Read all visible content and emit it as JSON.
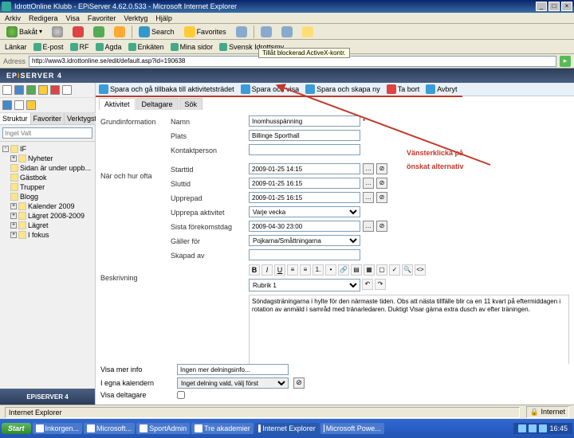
{
  "titlebar": {
    "title": "IdrottOnline Klubb - EPiServer 4.62.0.533 - Microsoft Internet Explorer"
  },
  "menubar": {
    "items": [
      "Arkiv",
      "Redigera",
      "Visa",
      "Favoriter",
      "Verktyg",
      "Hjälp"
    ]
  },
  "ie_toolbar": {
    "back": "Bakåt",
    "search": "Search",
    "favorites": "Favorites"
  },
  "links_toolbar": {
    "label": "Länkar",
    "items": [
      "E-post",
      "RF",
      "Agda",
      "Enkäten",
      "Mina sidor",
      "Svensk Idrottsmy"
    ]
  },
  "address": {
    "label": "Adress",
    "url": "http://www3.idrottonline.se/edit/default.asp?id=190638"
  },
  "addon_popup": "Tillåt blockerad ActiveX-kontr.",
  "epi_brand": "EPiSERVER 4",
  "left": {
    "tabs": [
      "Struktur",
      "Favoriter",
      "Verktygsfält"
    ],
    "search_placeholder": "Inget Valt",
    "tree": {
      "root": "IF",
      "items": [
        "Nyheter",
        "Sidan är under uppb...",
        "Gästbok",
        "Trupper",
        "Blogg",
        "Kalender 2009",
        "Lägret 2008-2009",
        "Lägret",
        "I fokus"
      ]
    },
    "footer": "EPiSERVER 4"
  },
  "action_bar": {
    "save_return": "Spara och gå tillbaka till aktivitetsträdet",
    "save_view": "Spara och visa",
    "save_as": "Spara och skapa ny",
    "delete": "Ta bort",
    "cancel": "Avbryt"
  },
  "form_tabs": [
    "Aktivitet",
    "Deltagare",
    "Sök"
  ],
  "form": {
    "group1_label": "Grundinformation",
    "name_label": "Namn",
    "name_value": "Inomhusspänning",
    "place_label": "Plats",
    "place_value": "Billinge Sporthall",
    "contact_label": "Kontaktperson",
    "group2_label": "När och hur ofta",
    "start_label": "Starttid",
    "start_value": "2009-01-25 14:15",
    "end_label": "Sluttid",
    "end_value": "2009-01-25 16:15",
    "recurrence_label": "Upprepad",
    "recurrence_value": "2009-01-25 16:15",
    "repeat_type_label": "Upprepa aktivitet",
    "repeat_type_value": "Varje vecka",
    "repeat_end_label": "Sista förekomstdag",
    "repeat_end_value": "2009-04-30 23:00",
    "group_label": "Gäller för",
    "group_value": "Pojkarna/Småttningarna",
    "creator_label": "Skapad av",
    "desc_label": "Beskrivning",
    "editor_style": "Rubrik 1",
    "editor_text": "Söndagsträningarna i hylte för den närmaste tiden. Obs att nästa tillfälle blir ca en 11 kvart på eftermiddagen i rotation av anmäld i samråd med tränarledaren. Duktigt Visar gärna extra dusch av efter träningen.",
    "moreinfo_label": "Visa mer info",
    "moreinfo_value": "Ingen mer delningsinfo...",
    "incal_label": "I egna kalendern",
    "approval_label": "Inget delning vald, välj först",
    "contacts_label": "Visa deltagare"
  },
  "annotation": {
    "line1": "Vänsterklicka på",
    "line2": "önskat alternativ"
  },
  "statusbar": {
    "zone": "Internet Explorer",
    "lock": "Internet"
  },
  "taskbar": {
    "start": "Start",
    "buttons": [
      "Inkorgen...",
      "Microsoft...",
      "SportAdmin",
      "Tre akademier",
      "Internet Explorer",
      "Microsoft Powe..."
    ],
    "active_index": 4,
    "clock": "16:45"
  }
}
